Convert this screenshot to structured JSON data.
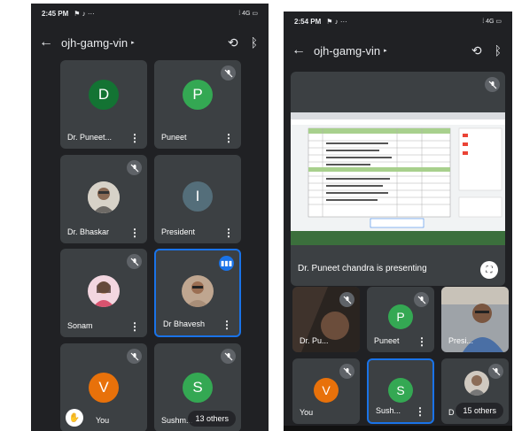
{
  "left": {
    "status_time": "2:45 PM",
    "status_icons": "⚑ ♪ ···",
    "status_signal": "⁞ 4G ▭",
    "meeting_code": "ojh-gamg-vin",
    "caret": "▸",
    "participants": [
      {
        "name": "Dr. Puneet...",
        "initial": "D",
        "color": "#137333",
        "muted": false
      },
      {
        "name": "Puneet",
        "initial": "P",
        "color": "#34a853",
        "muted": true
      },
      {
        "name": "Dr. Bhaskar",
        "initial": "",
        "color": "",
        "muted": true,
        "photo": true
      },
      {
        "name": "President",
        "initial": "I",
        "color": "#546e7a",
        "muted": false
      },
      {
        "name": "Sonam",
        "initial": "",
        "color": "",
        "muted": true,
        "photo": true
      },
      {
        "name": "Dr Bhavesh",
        "initial": "",
        "color": "",
        "muted": false,
        "photo": true,
        "speaking": true
      },
      {
        "name": "You",
        "initial": "V",
        "color": "#e8710a",
        "muted": true
      },
      {
        "name": "Sushm...",
        "initial": "S",
        "color": "#34a853",
        "muted": true
      }
    ],
    "others": "13 others",
    "menu": "⋮"
  },
  "right": {
    "status_time": "2:54 PM",
    "status_icons": "⚑ ♪ ···",
    "status_signal": "⁞ 4G ▭",
    "meeting_code": "ojh-gamg-vin",
    "caret": "▸",
    "presenting_text": "Dr. Puneet chandra is presenting",
    "participants": [
      {
        "name": "Dr. Pu...",
        "photo": true,
        "muted": true
      },
      {
        "name": "Puneet",
        "initial": "P",
        "color": "#34a853",
        "muted": true
      },
      {
        "name": "Presi...",
        "photo": true,
        "muted": false
      },
      {
        "name": "You",
        "initial": "V",
        "color": "#e8710a",
        "muted": true
      },
      {
        "name": "Sush...",
        "initial": "S",
        "color": "#34a853",
        "muted": false,
        "active": true
      },
      {
        "name": "D",
        "photo": true,
        "muted": true
      }
    ],
    "others": "15 others",
    "menu": "⋮"
  },
  "icons": {
    "back": "←",
    "camera_switch": "⟲",
    "bluetooth": "ᛒ",
    "mic_off": "🎙",
    "speaking": "▮▮▮",
    "hand": "✋",
    "fullscreen": "⛶"
  }
}
